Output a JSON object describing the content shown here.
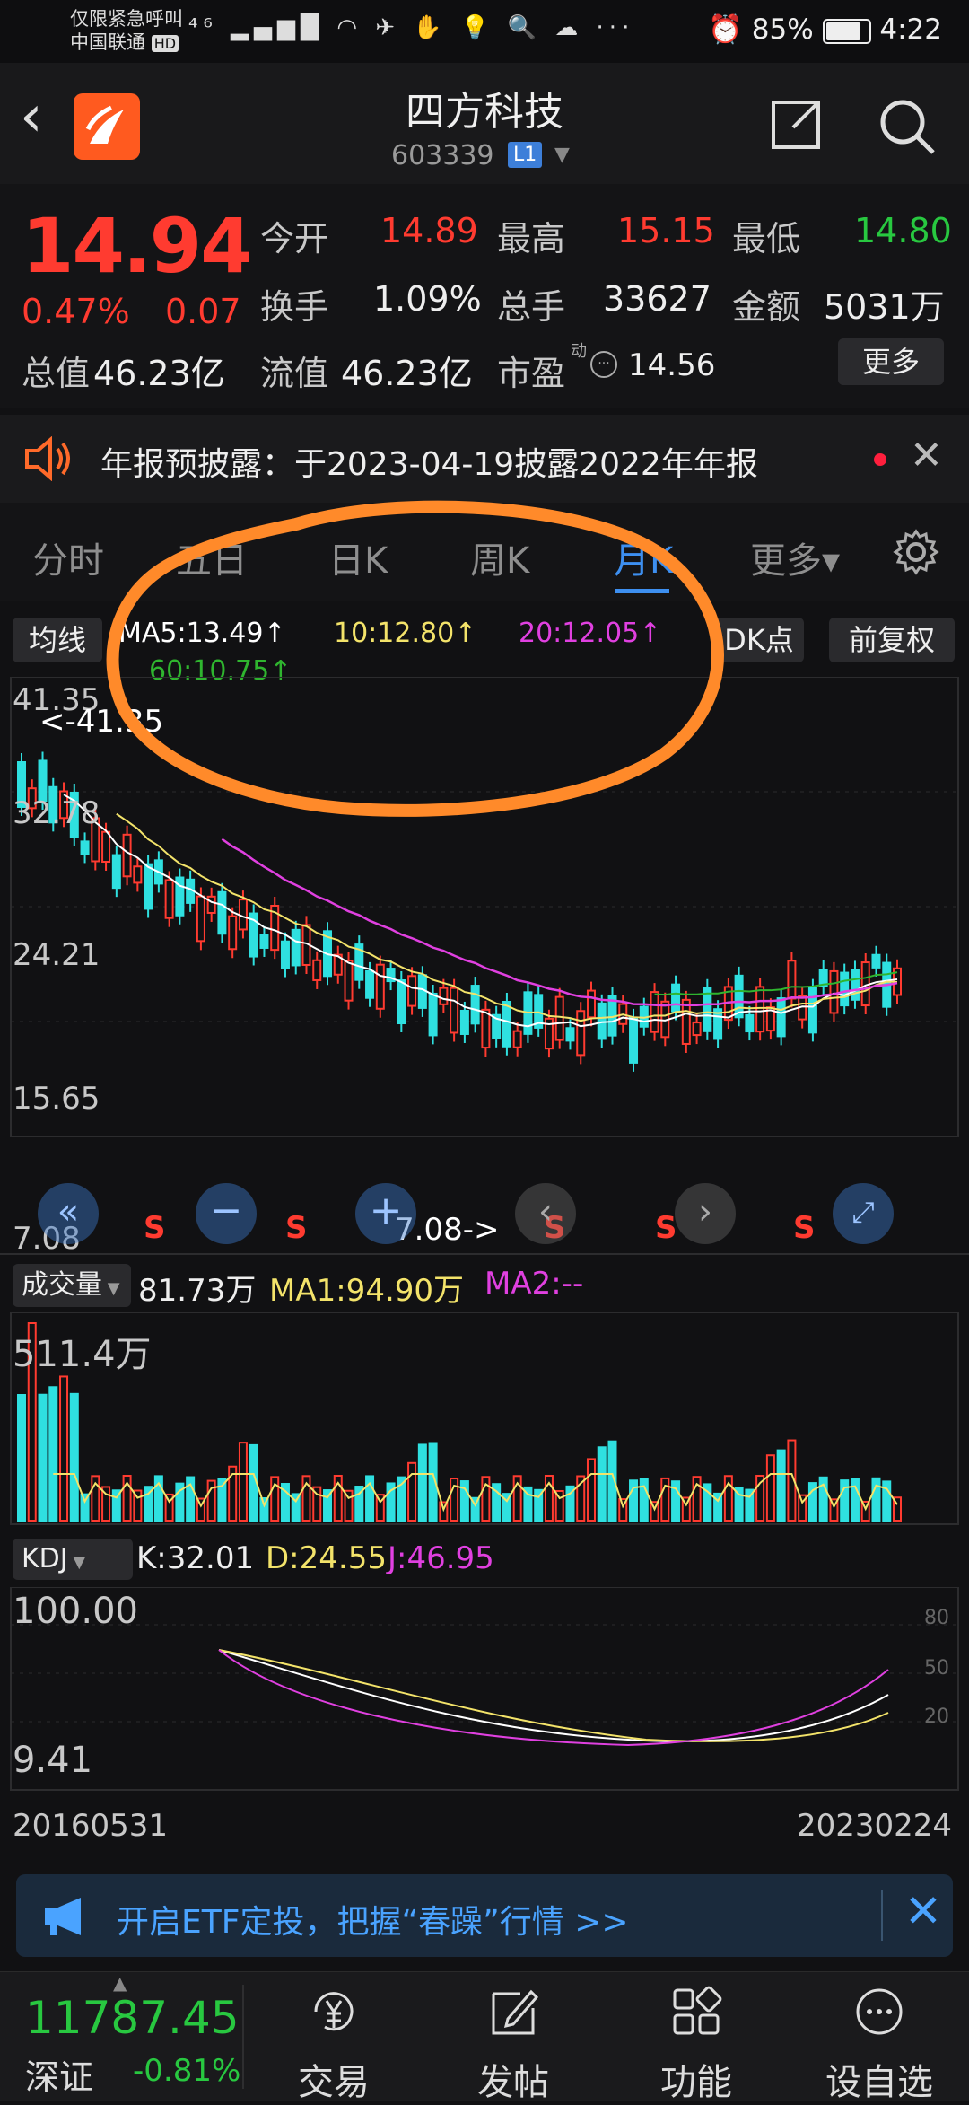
{
  "status_bar": {
    "carrier_line1": "仅限紧急呼叫",
    "carrier_line2": "中国联通",
    "hd": "HD",
    "icons": "⁴⁶ ▂▄▆█ ◠ ✈ ✋ 💡 🔍 ☁ ···",
    "battery": "85%",
    "time": "4:22"
  },
  "header": {
    "title": "四方科技",
    "code": "603339",
    "level_badge": "L1"
  },
  "quote": {
    "price": "14.94",
    "change_pct": "0.47%",
    "change_abs": "0.07",
    "rows": [
      [
        {
          "label": "今开",
          "value": "14.89",
          "color": "red"
        },
        {
          "label": "最高",
          "value": "15.15",
          "color": "red"
        },
        {
          "label": "最低",
          "value": "14.80",
          "color": "green"
        }
      ],
      [
        {
          "label": "换手",
          "value": "1.09%",
          "color": "white"
        },
        {
          "label": "总手",
          "value": "33627",
          "color": "white"
        },
        {
          "label": "金额",
          "value": "5031万",
          "color": "white"
        }
      ]
    ],
    "total_value_label": "总值",
    "total_value": "46.23亿",
    "float_value_label": "流值",
    "float_value": "46.23亿",
    "pe_label": "市盈",
    "pe_sup": "动",
    "pe_value": "14.56",
    "more_button": "更多"
  },
  "notice": {
    "text": "年报预披露：于2023-04-19披露2022年年报"
  },
  "tabs": [
    "分时",
    "五日",
    "日K",
    "周K",
    "月K",
    "更多▾"
  ],
  "active_tab": "月K",
  "kchart": {
    "indicator_button": "均线",
    "ma5": "MA5:13.49↑",
    "ma10": "10:12.80↑",
    "ma20": "20:12.05↑",
    "ma60": "60:10.75↑",
    "dk_button": "DK点",
    "adjust_button": "前复权",
    "high_marker": "<-41.35",
    "low_marker": "7.08->",
    "s_marker": "S",
    "y_ticks": [
      "41.35",
      "32.78",
      "24.21",
      "15.65",
      "7.08"
    ]
  },
  "volume": {
    "selector": "成交量",
    "value": "81.73万",
    "ma1": "MA1:94.90万",
    "ma2": "MA2:--",
    "max_label": "511.4万"
  },
  "kdj": {
    "selector": "KDJ",
    "k": "K:32.01",
    "d": "D:24.55",
    "j": "J:46.95",
    "top_label": "100.00",
    "bottom_label": "9.41",
    "right_ticks": [
      "80",
      "50",
      "20"
    ],
    "start_date": "20160531",
    "end_date": "20230224"
  },
  "banner": {
    "text": "开启ETF定投，把握“春躁”行情 >>"
  },
  "bottom_bar": {
    "index_value": "11787.45",
    "index_name": "深证",
    "index_change": "-0.81%",
    "nav": [
      {
        "label": "交易",
        "icon": "yen-trade-icon"
      },
      {
        "label": "发帖",
        "icon": "edit-post-icon"
      },
      {
        "label": "功能",
        "icon": "grid-function-icon"
      },
      {
        "label": "设自选",
        "icon": "more-dots-icon"
      }
    ]
  },
  "colors": {
    "up": "#ff3b30",
    "down": "#28c840",
    "accent": "#3d8ff0",
    "ma5": "#ffffff",
    "ma10": "#f3e36a",
    "ma20": "#e040e0",
    "ma60": "#2fb52f",
    "annotation": "#ff8a2a"
  }
}
